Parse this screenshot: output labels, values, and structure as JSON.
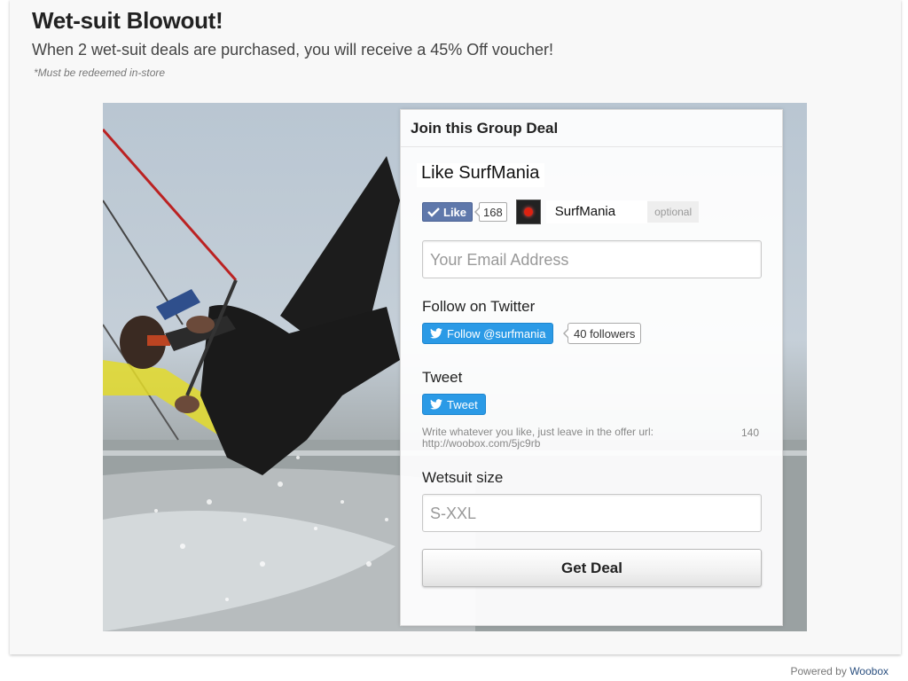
{
  "header": {
    "title": "Wet-suit Blowout!",
    "subtitle": "When 2 wet-suit deals are purchased, you will receive a 45% Off voucher!",
    "note": "*Must be redeemed in-store"
  },
  "panel": {
    "heading": "Join this Group Deal",
    "like": {
      "title": "Like SurfMania",
      "button_label": "Like",
      "count": "168",
      "page_name": "SurfMania",
      "optional_label": "optional"
    },
    "email": {
      "placeholder": "Your Email Address"
    },
    "twitter": {
      "label": "Follow on Twitter",
      "button_label": "Follow @surfmania",
      "followers": "40 followers"
    },
    "tweet": {
      "label": "Tweet",
      "button_label": "Tweet",
      "hint": "Write whatever you like, just leave in the offer url: http://woobox.com/5jc9rb",
      "char_count": "140"
    },
    "wetsuit": {
      "label": "Wetsuit size",
      "placeholder": "S-XXL"
    },
    "submit_label": "Get Deal"
  },
  "footer": {
    "powered_label": "Powered by",
    "brand": "Woobox"
  },
  "colors": {
    "facebook_blue": "#5f78ab",
    "twitter_blue": "#2b9ae6",
    "brand_link": "#2a4f7f"
  },
  "icons": [
    "check-icon",
    "twitter-bird-icon"
  ]
}
